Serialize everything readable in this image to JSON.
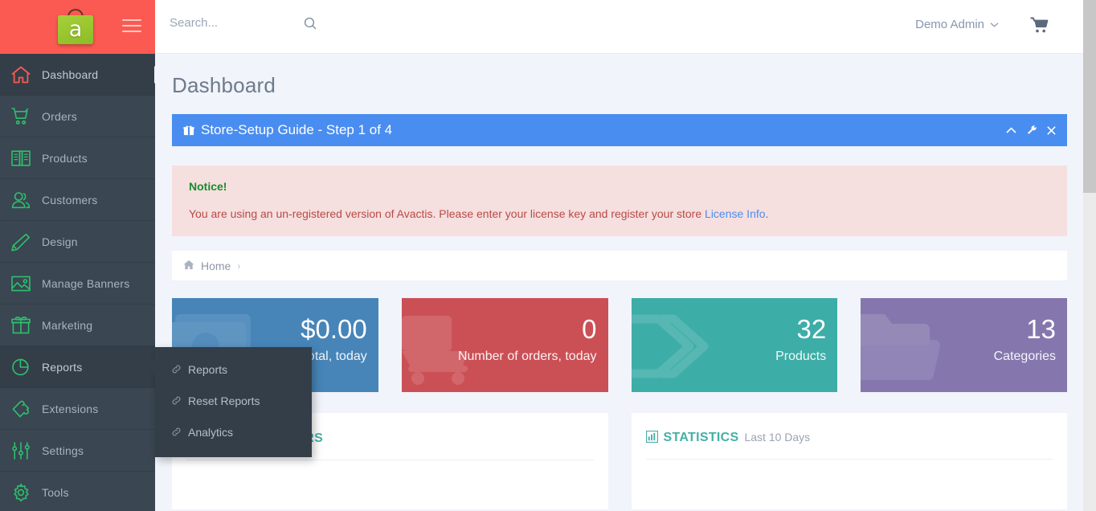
{
  "brand": {
    "logo_letter": "a",
    "logo_bg_color": "#8cbd26",
    "header_bg_color": "#fa5a52"
  },
  "topbar": {
    "search_placeholder": "Search...",
    "search_value": "",
    "user_name": "Demo Admin",
    "cart_icon": "cart-icon",
    "search_icon": "search-icon",
    "chevron_icon": "chevron-down-icon"
  },
  "sidebar": {
    "items": [
      {
        "label": "Dashboard",
        "icon": "home-icon",
        "active": true
      },
      {
        "label": "Orders",
        "icon": "shopping-cart-icon",
        "active": false
      },
      {
        "label": "Products",
        "icon": "book-icon",
        "active": false
      },
      {
        "label": "Customers",
        "icon": "users-icon",
        "active": false
      },
      {
        "label": "Design",
        "icon": "pencil-icon",
        "active": false
      },
      {
        "label": "Manage Banners",
        "icon": "image-icon",
        "active": false
      },
      {
        "label": "Marketing",
        "icon": "gift-icon",
        "active": false
      },
      {
        "label": "Reports",
        "icon": "pie-chart-icon",
        "active": true
      },
      {
        "label": "Extensions",
        "icon": "puzzle-icon",
        "active": false
      },
      {
        "label": "Settings",
        "icon": "sliders-icon",
        "active": false
      },
      {
        "label": "Tools",
        "icon": "gear-icon",
        "active": false
      }
    ]
  },
  "submenu": {
    "parent": "Reports",
    "items": [
      {
        "label": "Reports",
        "icon": "link-icon"
      },
      {
        "label": "Reset Reports",
        "icon": "link-icon"
      },
      {
        "label": "Analytics",
        "icon": "link-icon"
      }
    ]
  },
  "main": {
    "page_title": "Dashboard",
    "setup_panel": {
      "icon": "gift-icon",
      "title": "Store-Setup Guide - Step 1 of 4",
      "bg_color": "#4a8df0",
      "tools": [
        {
          "name": "collapse-icon",
          "glyph": "chevron-up"
        },
        {
          "name": "wrench-icon",
          "glyph": "wrench"
        },
        {
          "name": "close-icon",
          "glyph": "times"
        }
      ]
    },
    "notice": {
      "title": "Notice!",
      "text_before": "You are using an un-registered version of Avactis. Please enter your license key and register your store ",
      "link_text": "License Info",
      "text_after": ".",
      "bg_color": "#f6dfdf",
      "title_color": "#178c2c",
      "text_color": "#b84a46"
    },
    "breadcrumb": {
      "icon": "home-icon",
      "items": [
        "Home"
      ],
      "separator": "›"
    },
    "cards": [
      {
        "value": "$0.00",
        "label": "Total, today",
        "color": "#4785b8",
        "icon": "money-icon"
      },
      {
        "value": "0",
        "label": "Number of orders, today",
        "color": "#cb5055",
        "icon": "cart-icon"
      },
      {
        "value": "32",
        "label": "Products",
        "color": "#3dada8",
        "icon": "tags-icon"
      },
      {
        "value": "13",
        "label": "Categories",
        "color": "#8577ae",
        "icon": "folder-icon"
      }
    ],
    "panels": [
      {
        "icon": "document-icon",
        "title": "RECENT VISITORS",
        "subtitle": ""
      },
      {
        "icon": "bar-chart-icon",
        "title": "STATISTICS",
        "subtitle": "Last 10 Days"
      }
    ]
  },
  "scrollbar": {
    "name": "vertical-scrollbar",
    "thumb": "scrollbar-thumb"
  }
}
